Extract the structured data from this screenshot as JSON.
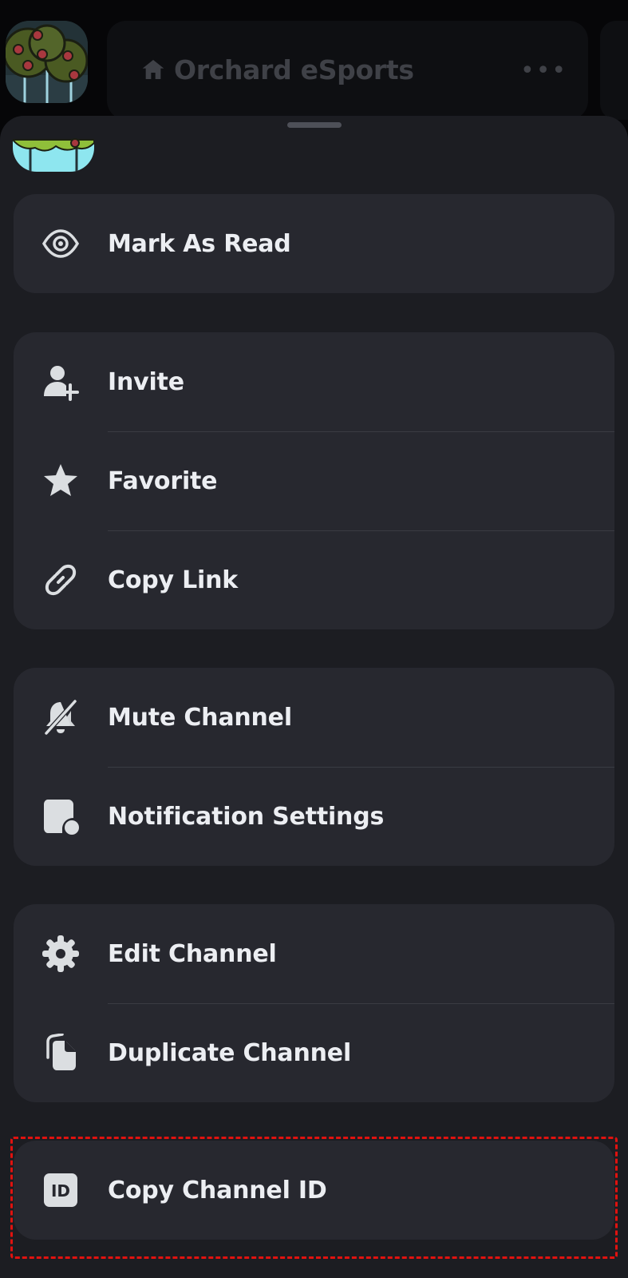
{
  "header": {
    "server_name": "Orchard eSports",
    "more_icon": "ellipsis-icon",
    "home_icon": "home-icon"
  },
  "sheet": {
    "groups": [
      {
        "items": [
          {
            "label": "Mark As Read",
            "icon": "eye-icon"
          }
        ]
      },
      {
        "items": [
          {
            "label": "Invite",
            "icon": "user-plus-icon"
          },
          {
            "label": "Favorite",
            "icon": "star-icon"
          },
          {
            "label": "Copy Link",
            "icon": "link-icon"
          }
        ]
      },
      {
        "items": [
          {
            "label": "Mute Channel",
            "icon": "bell-slash-icon"
          },
          {
            "label": "Notification Settings",
            "icon": "notification-settings-icon"
          }
        ]
      },
      {
        "items": [
          {
            "label": "Edit Channel",
            "icon": "gear-icon"
          },
          {
            "label": "Duplicate Channel",
            "icon": "duplicate-icon"
          }
        ]
      },
      {
        "items": [
          {
            "label": "Copy Channel ID",
            "icon": "id-badge-icon"
          }
        ]
      }
    ]
  },
  "colors": {
    "sheet_background": "#1c1d22",
    "group_background": "#27282f",
    "text": "#eceef2",
    "highlight": "#e0120f"
  }
}
